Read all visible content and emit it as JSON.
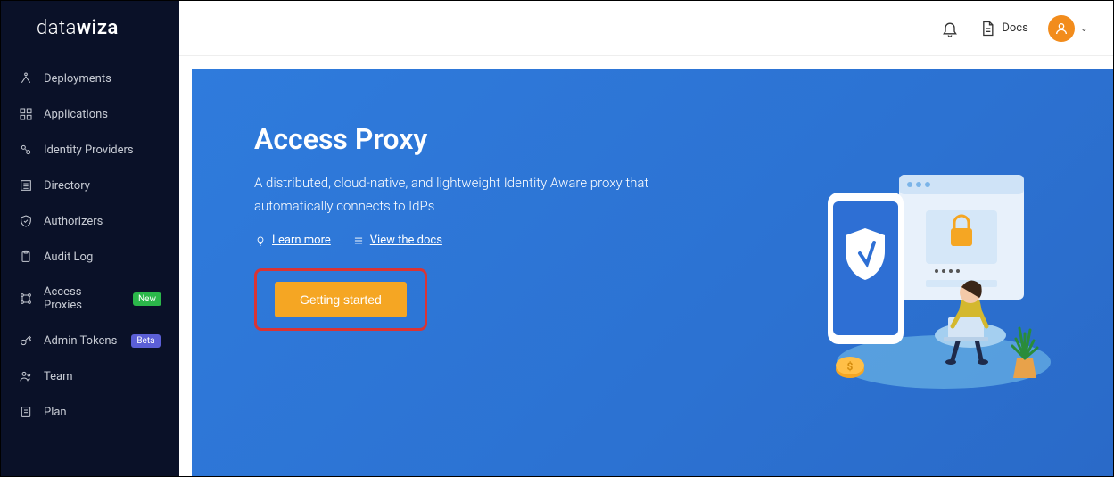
{
  "brand": {
    "pre": "data",
    "bold": "wiza"
  },
  "sidebar": {
    "items": [
      {
        "label": "Deployments",
        "icon": "deployments"
      },
      {
        "label": "Applications",
        "icon": "grid"
      },
      {
        "label": "Identity Providers",
        "icon": "identity"
      },
      {
        "label": "Directory",
        "icon": "list"
      },
      {
        "label": "Authorizers",
        "icon": "shield-check"
      },
      {
        "label": "Audit Log",
        "icon": "clipboard"
      },
      {
        "label": "Access Proxies",
        "icon": "proxy",
        "badge": "New",
        "badgeClass": "new"
      },
      {
        "label": "Admin Tokens",
        "icon": "key",
        "badge": "Beta",
        "badgeClass": "beta"
      },
      {
        "label": "Team",
        "icon": "team"
      },
      {
        "label": "Plan",
        "icon": "plan"
      }
    ]
  },
  "topbar": {
    "docs_label": "Docs"
  },
  "hero": {
    "title": "Access Proxy",
    "description": "A distributed, cloud-native, and lightweight Identity Aware proxy that automatically connects to IdPs",
    "learn_more": "Learn more",
    "view_docs": "View the docs",
    "cta": "Getting started"
  }
}
